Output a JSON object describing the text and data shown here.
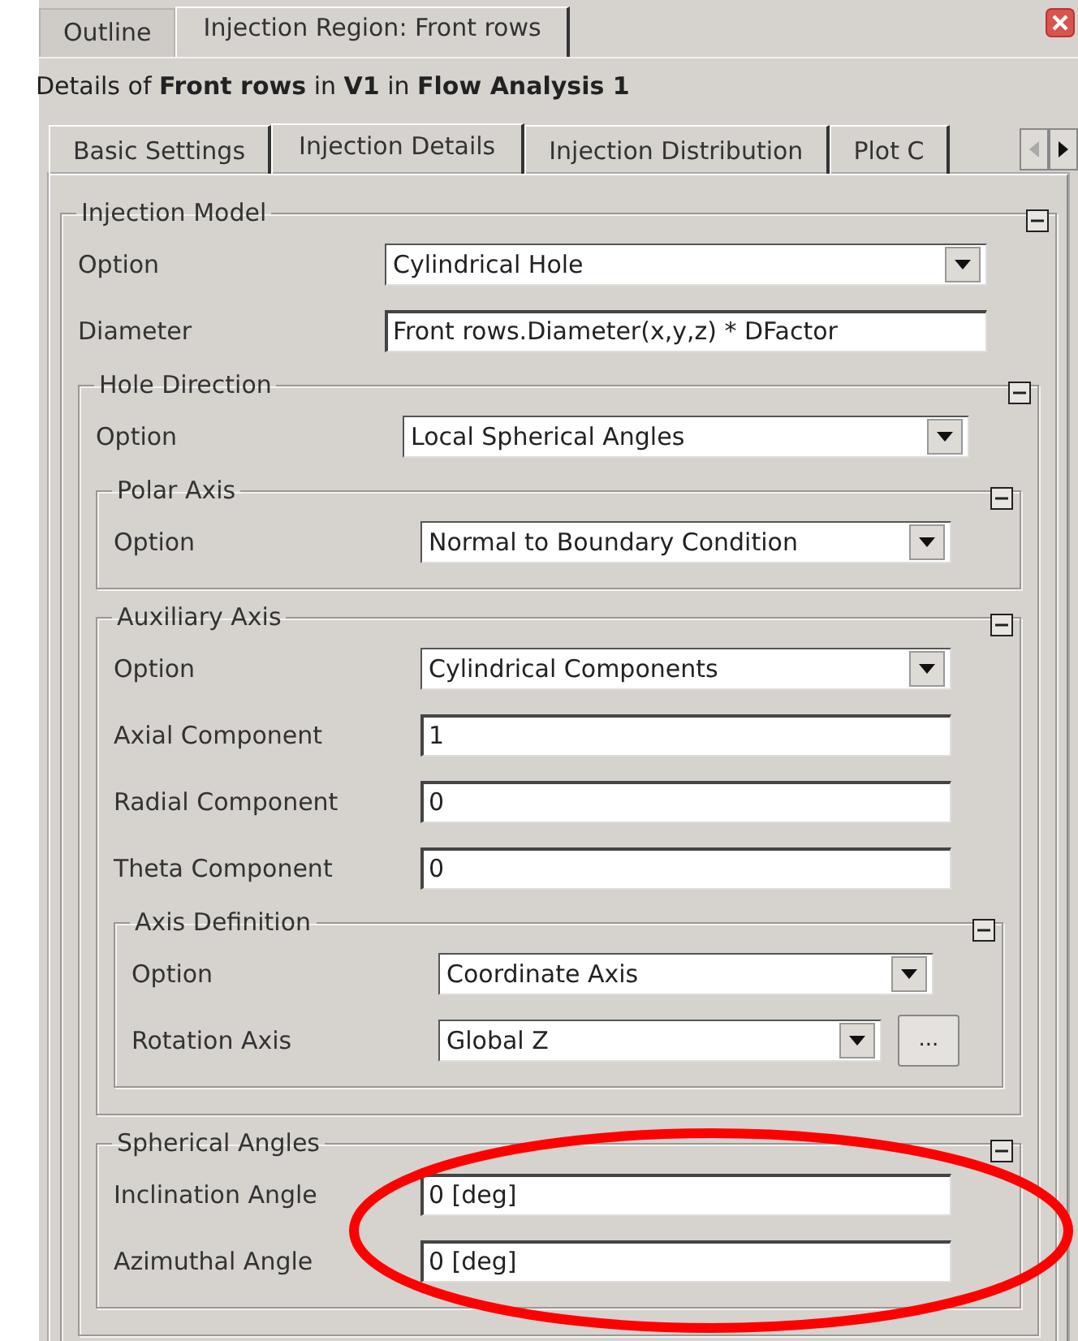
{
  "top_tabs": [
    {
      "label": "Outline",
      "selected": false
    },
    {
      "label": "Injection Region: Front rows",
      "selected": true
    }
  ],
  "details": "Details of **Front rows** in **V1** in **Flow Analysis 1**",
  "tabs": [
    {
      "label": "Basic Settings",
      "selected": false
    },
    {
      "label": "Injection Details",
      "selected": true
    },
    {
      "label": "Injection Distribution",
      "selected": false
    },
    {
      "label": "Plot C",
      "selected": false
    }
  ],
  "groups": [
    {
      "title": "Injection Model",
      "rows": [
        {
          "kind": "dropdown",
          "label": "Option",
          "value": "Cylindrical Hole"
        },
        {
          "kind": "text",
          "label": "Diameter",
          "value": "Front rows.Diameter(x,y,z) * DFactor"
        }
      ],
      "groups": [
        {
          "title": "Hole Direction",
          "rows": [
            {
              "kind": "dropdown",
              "label": "Option",
              "value": "Local Spherical Angles"
            }
          ],
          "groups": [
            {
              "title": "Polar Axis",
              "rows": [
                {
                  "kind": "dropdown",
                  "label": "Option",
                  "value": "Normal to Boundary Condition"
                }
              ]
            },
            {
              "title": "Auxiliary Axis",
              "rows": [
                {
                  "kind": "dropdown",
                  "label": "Option",
                  "value": "Cylindrical Components"
                },
                {
                  "kind": "text",
                  "label": "Axial Component",
                  "value": "1"
                },
                {
                  "kind": "text",
                  "label": "Radial Component",
                  "value": "0"
                },
                {
                  "kind": "text",
                  "label": "Theta Component",
                  "value": "0"
                }
              ],
              "groups": [
                {
                  "title": "Axis Definition",
                  "rows": [
                    {
                      "kind": "dropdown",
                      "label": "Option",
                      "value": "Coordinate Axis"
                    },
                    {
                      "kind": "dropdown_browse",
                      "label": "Rotation Axis",
                      "value": "Global Z",
                      "button": "..."
                    }
                  ]
                }
              ]
            },
            {
              "title": "Spherical Angles",
              "rows": [
                {
                  "kind": "text",
                  "label": "Inclination Angle",
                  "value": "0 [deg]"
                },
                {
                  "kind": "text",
                  "label": "Azimuthal Angle",
                  "value": "0 [deg]"
                }
              ]
            }
          ]
        }
      ]
    }
  ],
  "annotation": {
    "kind": "ellipse"
  }
}
